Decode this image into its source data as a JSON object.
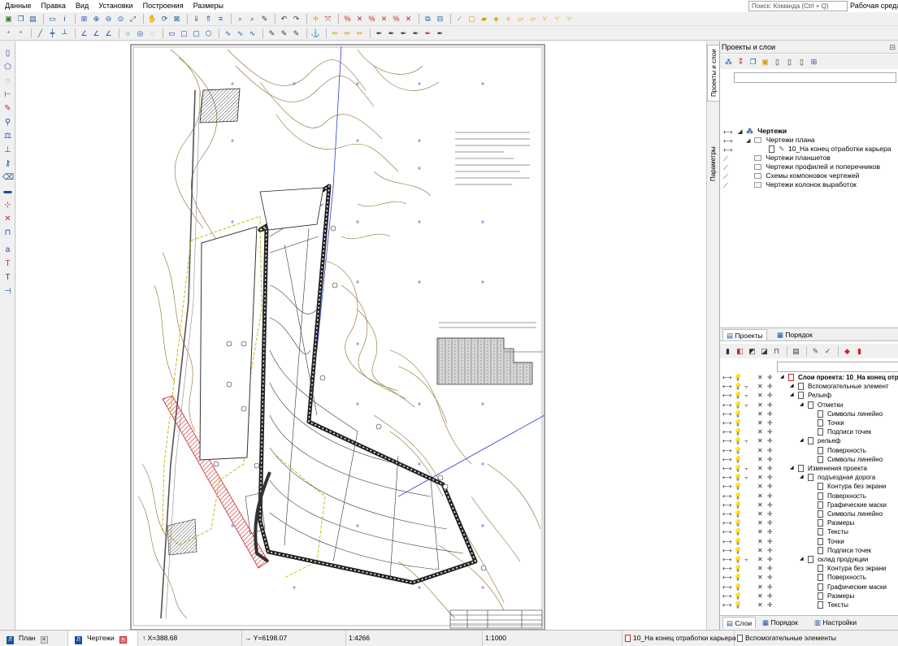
{
  "menu": [
    "Данные",
    "Правка",
    "Вид",
    "Установки",
    "Построения",
    "Размеры"
  ],
  "search": {
    "placeholder": "Поиск: Команда (Ctrl + Q)"
  },
  "workspace_label": "Рабочая среда",
  "panel": {
    "title": "Проекты и слои",
    "vertical_tabs": [
      "Проекты и слои",
      "Параметры"
    ],
    "tree": {
      "root": "Чертежи",
      "items": [
        {
          "label": "Чертежи плана"
        },
        {
          "label": "10_На конец отработки карьера"
        },
        {
          "label": "Чертежи планшетов"
        },
        {
          "label": "Чертежи профилей и поперечников"
        },
        {
          "label": "Схемы компоновок чертежей"
        },
        {
          "label": "Чертежи колонок выработок"
        }
      ]
    },
    "subtabs_top": [
      "Проекты",
      "Порядок"
    ],
    "layers": [
      {
        "label": "Слои проекта: 10_На конец отр",
        "level": 0,
        "bold": true
      },
      {
        "label": "Вспомогательные элемент",
        "level": 1
      },
      {
        "label": "Рельеф",
        "level": 1
      },
      {
        "label": "Отметки",
        "level": 2
      },
      {
        "label": "Символы линейно",
        "level": 3
      },
      {
        "label": "Точки",
        "level": 3
      },
      {
        "label": "Подписи точек",
        "level": 3
      },
      {
        "label": "рельеф",
        "level": 2
      },
      {
        "label": "Поверхность",
        "level": 3
      },
      {
        "label": "Символы линейно",
        "level": 3
      },
      {
        "label": "Изменения проекта",
        "level": 1
      },
      {
        "label": "подъездная дорога",
        "level": 2
      },
      {
        "label": "Контура без экрани",
        "level": 3
      },
      {
        "label": "Поверхность",
        "level": 3
      },
      {
        "label": "Графические маски",
        "level": 3
      },
      {
        "label": "Символы линейно",
        "level": 3
      },
      {
        "label": "Размеры",
        "level": 3
      },
      {
        "label": "Тексты",
        "level": 3
      },
      {
        "label": "Точки",
        "level": 3
      },
      {
        "label": "Подписи точек",
        "level": 3
      },
      {
        "label": "склад продукции",
        "level": 2
      },
      {
        "label": "Контура без экрани",
        "level": 3
      },
      {
        "label": "Поверхность",
        "level": 3
      },
      {
        "label": "Графические маски",
        "level": 3
      },
      {
        "label": "Размеры",
        "level": 3
      },
      {
        "label": "Тексты",
        "level": 3
      }
    ],
    "subtabs_bottom": [
      "Слои",
      "Порядок",
      "Настройки"
    ]
  },
  "statusbar": {
    "tabs": [
      {
        "label": "План"
      },
      {
        "label": "Чертежи"
      }
    ],
    "x": "X=388.68",
    "y": "Y=6198.07",
    "scale": "1:4266",
    "scale2": "1:1000",
    "active_drawing": "10_На конец отработки карьера",
    "active_layer": "Вспомогательные элементы"
  },
  "colors": {
    "accent": "#1b4f9c",
    "contour": "#8a6a2a",
    "hatch_red": "#c62828",
    "boundary_yellow": "#c9b400",
    "axis_blue": "#2a3fd1"
  }
}
